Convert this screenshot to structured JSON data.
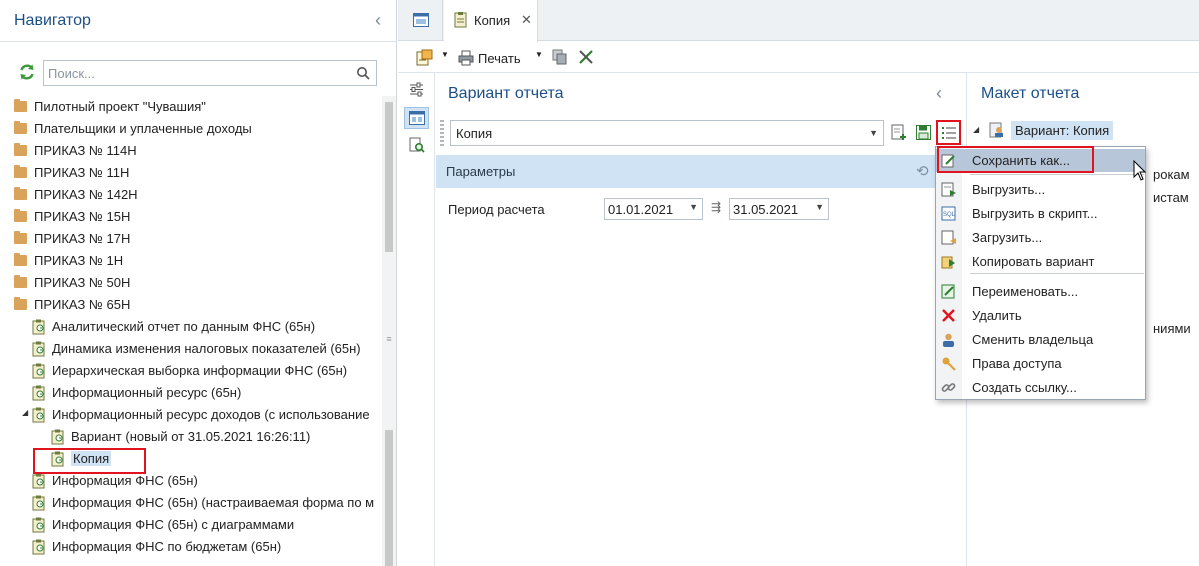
{
  "navigator": {
    "title": "Навигатор",
    "search_placeholder": "Поиск...",
    "tree": [
      {
        "label": "Пилотный проект \"Чувашия\"",
        "type": "folder"
      },
      {
        "label": "Плательщики и уплаченные доходы",
        "type": "folder"
      },
      {
        "label": "ПРИКАЗ № 114Н",
        "type": "folder"
      },
      {
        "label": "ПРИКАЗ № 11Н",
        "type": "folder"
      },
      {
        "label": "ПРИКАЗ № 142Н",
        "type": "folder"
      },
      {
        "label": "ПРИКАЗ № 15Н",
        "type": "folder"
      },
      {
        "label": "ПРИКАЗ № 17Н",
        "type": "folder"
      },
      {
        "label": "ПРИКАЗ № 1Н",
        "type": "folder"
      },
      {
        "label": "ПРИКАЗ № 50Н",
        "type": "folder"
      },
      {
        "label": "ПРИКАЗ № 65Н",
        "type": "folder-open"
      },
      {
        "label": "Аналитический отчет по данным ФНС (65н)",
        "type": "report"
      },
      {
        "label": "Динамика изменения налоговых показателей (65н)",
        "type": "report"
      },
      {
        "label": "Иерархическая выборка информации ФНС (65н)",
        "type": "report"
      },
      {
        "label": "Информационный ресурс (65н)",
        "type": "report"
      },
      {
        "label": "Информационный ресурс доходов (с использование",
        "type": "report-expanded"
      },
      {
        "label": "Вариант (новый от 31.05.2021 16:26:11)",
        "type": "variant"
      },
      {
        "label": "Копия",
        "type": "variant-selected"
      },
      {
        "label": "Информация ФНС (65н)",
        "type": "report"
      },
      {
        "label": "Информация ФНС (65н) (настраиваемая форма по м",
        "type": "report"
      },
      {
        "label": "Информация ФНС (65н) с диаграммами",
        "type": "report"
      },
      {
        "label": "Информация ФНС по бюджетам (65н)",
        "type": "report"
      }
    ]
  },
  "tabs": {
    "active_label": "Копия",
    "close_symbol": "✕"
  },
  "toolbar": {
    "print_label": "Печать"
  },
  "variant_panel": {
    "title": "Вариант отчета",
    "selected_variant": "Копия",
    "params_label": "Параметры",
    "period_label": "Период расчета",
    "date_from": "01.01.2021",
    "date_to": "31.05.2021"
  },
  "maket_panel": {
    "title": "Макет отчета",
    "root_label": "Вариант: Копия",
    "partial_1": "рокам",
    "partial_2": "истам",
    "partial_3": "ниями"
  },
  "context_menu": {
    "items": [
      {
        "label": "Сохранить как...",
        "icon": "edit-save-icon",
        "active": true
      },
      {
        "label": "Выгрузить...",
        "icon": "export-icon"
      },
      {
        "label": "Выгрузить в скрипт...",
        "icon": "sql-script-icon"
      },
      {
        "label": "Загрузить...",
        "icon": "import-icon"
      },
      {
        "label": "Копировать вариант",
        "icon": "copy-variant-icon"
      },
      {
        "label": "Переименовать...",
        "icon": "rename-icon"
      },
      {
        "label": "Удалить",
        "icon": "delete-icon"
      },
      {
        "label": "Сменить владельца",
        "icon": "user-icon"
      },
      {
        "label": "Права доступа",
        "icon": "key-icon"
      },
      {
        "label": "Создать ссылку...",
        "icon": "link-icon"
      }
    ]
  },
  "colors": {
    "accent_title": "#1d4f86",
    "highlight_red": "#e0141e",
    "params_bg": "#cfe3f5",
    "menu_active": "#b8c6d9"
  }
}
